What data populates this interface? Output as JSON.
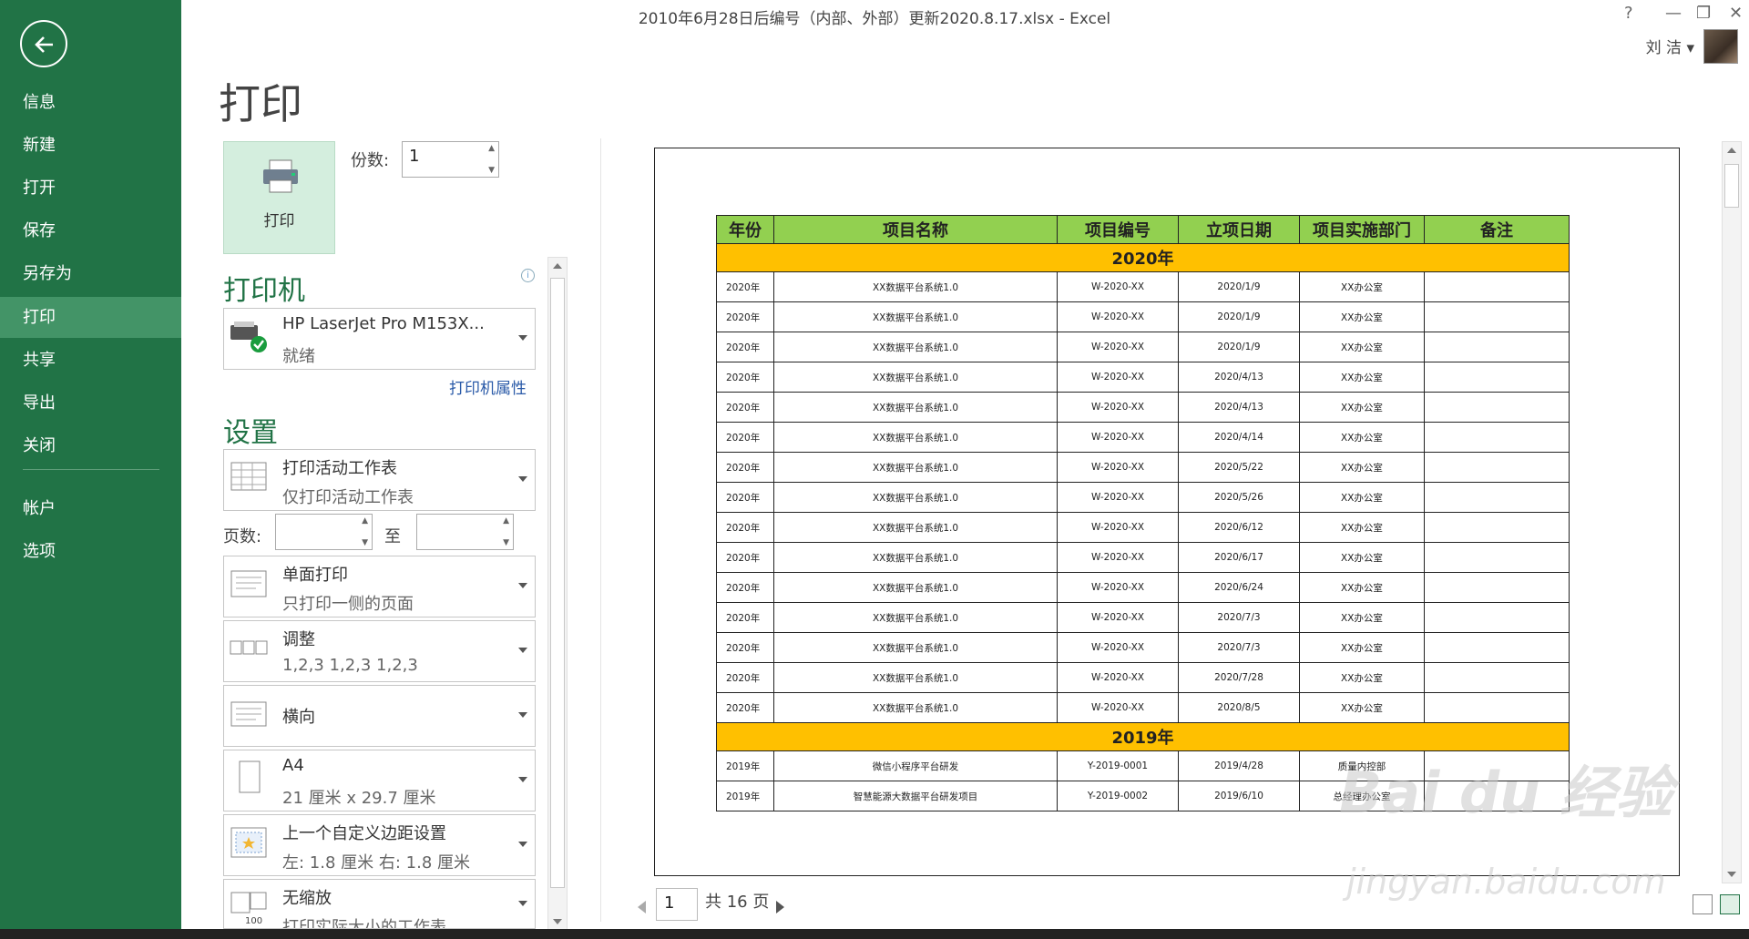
{
  "window": {
    "title": "2010年6月28日后编号（内部、外部）更新2020.8.17.xlsx - Excel",
    "help": "?",
    "minimize": "—",
    "restore": "❐",
    "close": "✕",
    "user": "刘 洁 ▾"
  },
  "nav": {
    "items": [
      "信息",
      "新建",
      "打开",
      "保存",
      "另存为",
      "打印",
      "共享",
      "导出",
      "关闭",
      "帐户",
      "选项"
    ],
    "active": "打印"
  },
  "print": {
    "title": "打印",
    "button_label": "打印",
    "copies_label": "份数:",
    "copies_value": "1",
    "printer_heading": "打印机",
    "printer_name": "HP LaserJet Pro M153X...",
    "printer_status": "就绪",
    "printer_props": "打印机属性",
    "settings_heading": "设置",
    "pages_label": "页数:",
    "to_label": "至",
    "settings": [
      {
        "line1": "打印活动工作表",
        "line2": "仅打印活动工作表"
      },
      {
        "line1": "单面打印",
        "line2": "只打印一侧的页面"
      },
      {
        "line1": "调整",
        "line2": "1,2,3    1,2,3    1,2,3"
      },
      {
        "line1": "横向",
        "line2": ""
      },
      {
        "line1": "A4",
        "line2": "21 厘米 x 29.7 厘米"
      },
      {
        "line1": "上一个自定义边距设置",
        "line2": "左: 1.8 厘米    右: 1.8 厘米"
      },
      {
        "line1": "无缩放",
        "line2": "打印实际大小的工作表"
      }
    ]
  },
  "preview": {
    "headers": [
      "年份",
      "项目名称",
      "项目编号",
      "立项日期",
      "项目实施部门",
      "备注"
    ],
    "group_2020": "2020年",
    "rows_2020": [
      [
        "2020年",
        "XX数据平台系统1.0",
        "W-2020-XX",
        "2020/1/9",
        "XX办公室",
        ""
      ],
      [
        "2020年",
        "XX数据平台系统1.0",
        "W-2020-XX",
        "2020/1/9",
        "XX办公室",
        ""
      ],
      [
        "2020年",
        "XX数据平台系统1.0",
        "W-2020-XX",
        "2020/1/9",
        "XX办公室",
        ""
      ],
      [
        "2020年",
        "XX数据平台系统1.0",
        "W-2020-XX",
        "2020/4/13",
        "XX办公室",
        ""
      ],
      [
        "2020年",
        "XX数据平台系统1.0",
        "W-2020-XX",
        "2020/4/13",
        "XX办公室",
        ""
      ],
      [
        "2020年",
        "XX数据平台系统1.0",
        "W-2020-XX",
        "2020/4/14",
        "XX办公室",
        ""
      ],
      [
        "2020年",
        "XX数据平台系统1.0",
        "W-2020-XX",
        "2020/5/22",
        "XX办公室",
        ""
      ],
      [
        "2020年",
        "XX数据平台系统1.0",
        "W-2020-XX",
        "2020/5/26",
        "XX办公室",
        ""
      ],
      [
        "2020年",
        "XX数据平台系统1.0",
        "W-2020-XX",
        "2020/6/12",
        "XX办公室",
        ""
      ],
      [
        "2020年",
        "XX数据平台系统1.0",
        "W-2020-XX",
        "2020/6/17",
        "XX办公室",
        ""
      ],
      [
        "2020年",
        "XX数据平台系统1.0",
        "W-2020-XX",
        "2020/6/24",
        "XX办公室",
        ""
      ],
      [
        "2020年",
        "XX数据平台系统1.0",
        "W-2020-XX",
        "2020/7/3",
        "XX办公室",
        ""
      ],
      [
        "2020年",
        "XX数据平台系统1.0",
        "W-2020-XX",
        "2020/7/3",
        "XX办公室",
        ""
      ],
      [
        "2020年",
        "XX数据平台系统1.0",
        "W-2020-XX",
        "2020/7/28",
        "XX办公室",
        ""
      ],
      [
        "2020年",
        "XX数据平台系统1.0",
        "W-2020-XX",
        "2020/8/5",
        "XX办公室",
        ""
      ]
    ],
    "group_2019": "2019年",
    "rows_2019": [
      [
        "2019年",
        "微信小程序平台研发",
        "Y-2019-0001",
        "2019/4/28",
        "质量内控部",
        ""
      ],
      [
        "2019年",
        "智慧能源大数据平台研发项目",
        "Y-2019-0002",
        "2019/6/10",
        "总经理办公室",
        ""
      ]
    ],
    "page_current": "1",
    "page_total": "共 16 页"
  },
  "watermark": {
    "main": "Bai du 经验",
    "sub": "jingyan.baidu.com"
  },
  "colors": {
    "nav": "#217346",
    "nav_active": "#439467",
    "header_fill": "#92d050",
    "group_fill": "#ffc000"
  }
}
